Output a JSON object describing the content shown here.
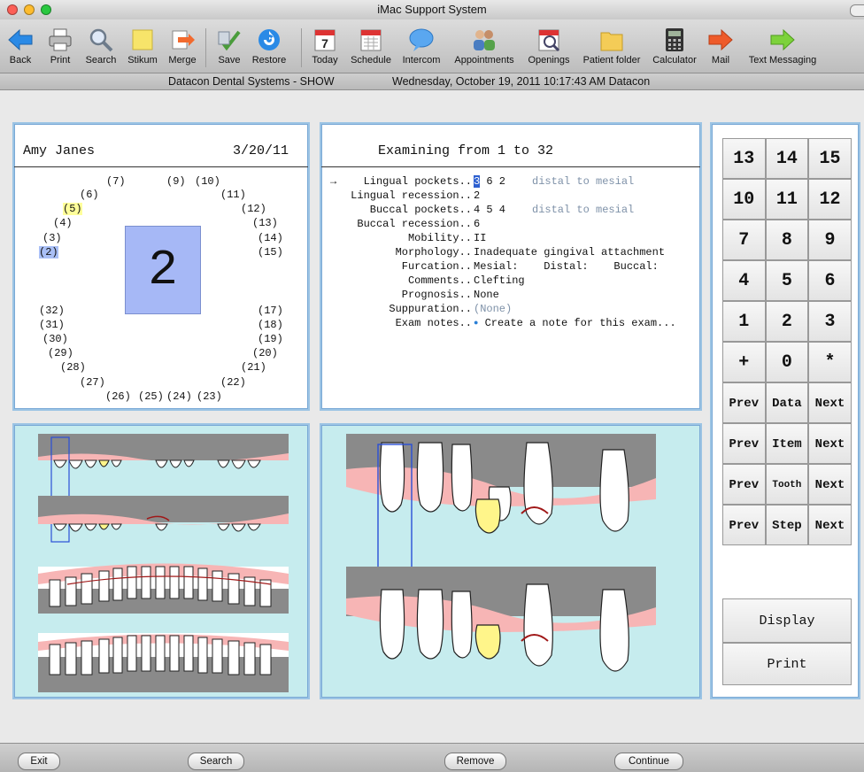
{
  "window": {
    "title": "iMac Support System"
  },
  "toolbar": {
    "items": [
      {
        "label": "Back",
        "icon": "back-arrow-icon"
      },
      {
        "label": "Print",
        "icon": "printer-icon"
      },
      {
        "label": "Search",
        "icon": "magnifier-icon"
      },
      {
        "label": "Stikum",
        "icon": "sticky-note-icon"
      },
      {
        "label": "Merge",
        "icon": "merge-icon"
      },
      {
        "label": "Save",
        "icon": "save-icon"
      },
      {
        "label": "Restore",
        "icon": "restore-icon"
      },
      {
        "label": "Today",
        "icon": "calendar-today-icon",
        "calendar_day": "7"
      },
      {
        "label": "Schedule",
        "icon": "schedule-icon"
      },
      {
        "label": "Intercom",
        "icon": "speech-bubble-icon"
      },
      {
        "label": "Appointments",
        "icon": "people-icon"
      },
      {
        "label": "Openings",
        "icon": "openings-icon"
      },
      {
        "label": "Patient folder",
        "icon": "folder-icon"
      },
      {
        "label": "Calculator",
        "icon": "calculator-icon"
      },
      {
        "label": "Mail",
        "icon": "mail-arrow-icon"
      },
      {
        "label": "Text Messaging",
        "icon": "text-arrow-icon"
      }
    ]
  },
  "status": {
    "company": "Datacon Dental Systems - SHOW",
    "datetime": "Wednesday, October 19, 2011  10:17:43 AM  Datacon"
  },
  "patient": {
    "name": "Amy Janes",
    "date": "3/20/11",
    "selected_tooth": "2",
    "teeth_labels": [
      "(7)",
      "(9)",
      "(10)",
      "(6)",
      "(11)",
      "(5)",
      "(12)",
      "(4)",
      "(13)",
      "(3)",
      "(14)",
      "(2)",
      "(15)",
      "(32)",
      "(17)",
      "(31)",
      "(18)",
      "(30)",
      "(19)",
      "(29)",
      "(20)",
      "(28)",
      "(21)",
      "(27)",
      "(22)",
      "(26)",
      "(25)",
      "(24)",
      "(23)"
    ]
  },
  "exam": {
    "title": "Examining from 1 to 32",
    "arrow": "→",
    "rows": [
      {
        "label": "Lingual pockets..",
        "value": "3  6  2",
        "note": "distal to mesial",
        "active": true,
        "highlight": "3"
      },
      {
        "label": "Lingual recession..",
        "value": "2"
      },
      {
        "label": "Buccal pockets..",
        "value": "4  5  4",
        "note": "distal to mesial"
      },
      {
        "label": "Buccal recession..",
        "value": "6"
      },
      {
        "label": "Mobility..",
        "value": "II"
      },
      {
        "label": "Morphology..",
        "value": "Inadequate gingival attachment"
      },
      {
        "label": "Furcation..",
        "value": "Mesial:    Distal:    Buccal:"
      },
      {
        "label": "Comments..",
        "value": "Clefting"
      },
      {
        "label": "Prognosis..",
        "value": "None"
      },
      {
        "label": "Suppuration..",
        "value": "(None)",
        "dim": true
      },
      {
        "label": "Exam notes..",
        "value": "Create a note for this exam..."
      }
    ]
  },
  "keypad": {
    "keys": [
      "13",
      "14",
      "15",
      "10",
      "11",
      "12",
      "7",
      "8",
      "9",
      "4",
      "5",
      "6",
      "1",
      "2",
      "3",
      "+",
      "0",
      "*"
    ],
    "nav_rows": [
      {
        "prev": "Prev",
        "mid": "Data",
        "next": "Next"
      },
      {
        "prev": "Prev",
        "mid": "Item",
        "next": "Next"
      },
      {
        "prev": "Prev",
        "mid": "Tooth",
        "next": "Next"
      },
      {
        "prev": "Prev",
        "mid": "Step",
        "next": "Next"
      }
    ],
    "display_label": "Display",
    "print_label": "Print"
  },
  "bottom": {
    "exit": "Exit",
    "search": "Search",
    "remove": "Remove",
    "continue": "Continue"
  },
  "colors": {
    "panel_border": "#9cc4e4",
    "chart_bg": "#c6ecee",
    "gum": "#f7b5b5",
    "bone": "#8a8a8a",
    "highlight_yellow": "#ffff9a",
    "highlight_blue": "#a6b8f6"
  }
}
